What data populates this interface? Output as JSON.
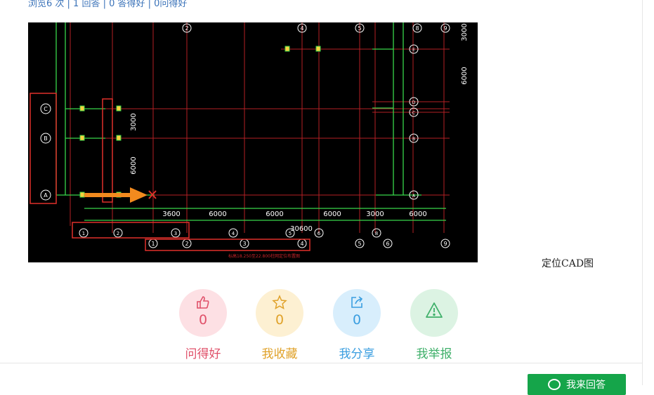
{
  "stats": {
    "text": "浏览6 次 | 1 回答 | 0 答得好 | 0问得好"
  },
  "cad": {
    "grid_top": [
      "2",
      "4",
      "5",
      "8",
      "9"
    ],
    "grid_bottom": [
      "1",
      "2",
      "3",
      "4",
      "5",
      "6",
      "9"
    ],
    "grid_mid": [
      "1",
      "2",
      "3",
      "4",
      "5",
      "6",
      "8"
    ],
    "rows_left": [
      "C",
      "B",
      "A"
    ],
    "rows_right": [
      "E",
      "D",
      "C",
      "B",
      "A"
    ],
    "dims_bottom": [
      "3600",
      "6000",
      "6000",
      "6000",
      "3000",
      "6000"
    ],
    "dim_total": "30600",
    "dims_vertical": [
      "3000",
      "6000"
    ],
    "dims_right": [
      "3000",
      "6000"
    ],
    "footer_note": "标高18.250至22.800柱网定位布置图"
  },
  "caption": {
    "text": "定位CAD图"
  },
  "actions": [
    {
      "label": "问得好",
      "count": "0",
      "color": "#e0516a",
      "bg": "#fde0e4",
      "icon": "thumbs-up-icon"
    },
    {
      "label": "我收藏",
      "count": "0",
      "color": "#e0a22a",
      "bg": "#fdf0d2",
      "icon": "star-icon"
    },
    {
      "label": "我分享",
      "count": "0",
      "color": "#3a9ee0",
      "bg": "#d8eefc",
      "icon": "share-icon"
    },
    {
      "label": "我举报",
      "count": "",
      "color": "#3fb06a",
      "bg": "#dcf3e3",
      "icon": "warning-icon"
    }
  ],
  "answer_button": {
    "label": "我来回答"
  }
}
